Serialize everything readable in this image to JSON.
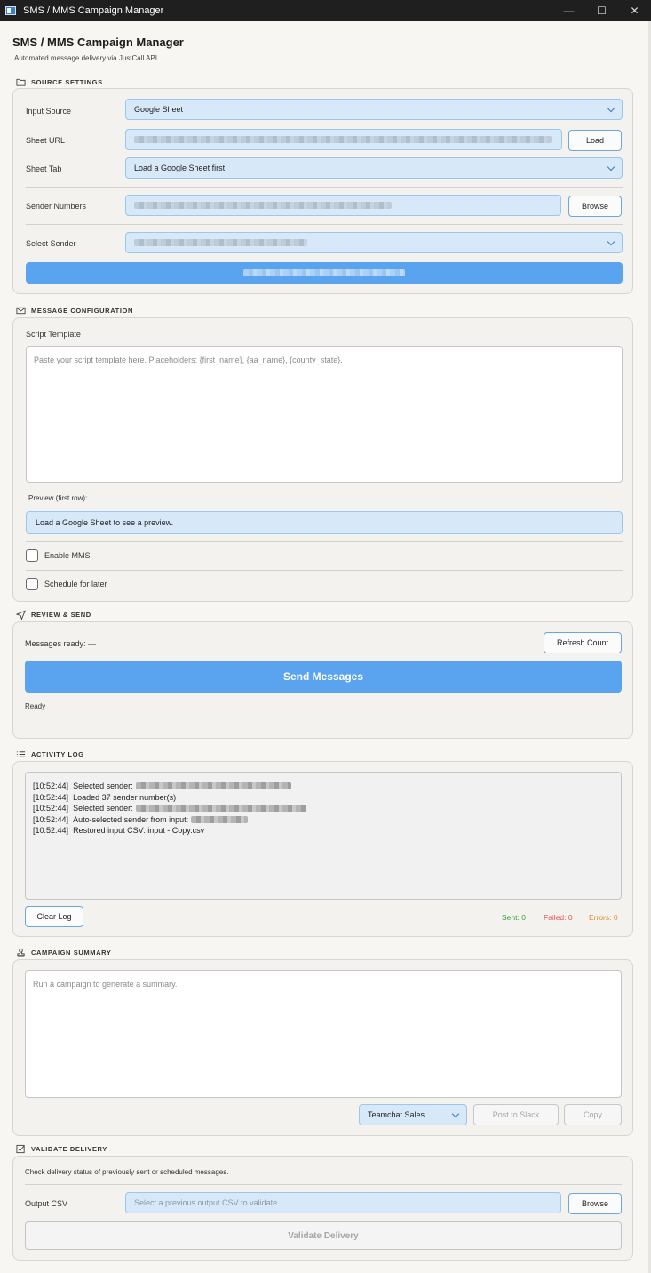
{
  "window": {
    "title": "SMS / MMS Campaign Manager",
    "controls": {
      "minimize": "—",
      "maximize": "☐",
      "close": "✕"
    }
  },
  "header": {
    "title": "SMS / MMS Campaign Manager",
    "subtitle": "Automated message delivery via JustCall API"
  },
  "source_settings": {
    "heading": "SOURCE SETTINGS",
    "input_source_label": "Input Source",
    "input_source_value": "Google Sheet",
    "sheet_url_label": "Sheet URL",
    "load_button": "Load",
    "sheet_tab_label": "Sheet Tab",
    "sheet_tab_value": "Load a Google Sheet first",
    "sender_numbers_label": "Sender Numbers",
    "browse_button": "Browse",
    "select_sender_label": "Select Sender"
  },
  "message_config": {
    "heading": "MESSAGE CONFIGURATION",
    "script_template_label": "Script Template",
    "script_placeholder": "Paste your script template here. Placeholders: {first_name}, {aa_name}, {county_state}.",
    "preview_label": "Preview (first row):",
    "preview_value": "Load a Google Sheet to see a preview.",
    "enable_mms": "Enable MMS",
    "schedule_later": "Schedule for later"
  },
  "review_send": {
    "heading": "REVIEW & SEND",
    "messages_ready": "Messages ready: —",
    "refresh_button": "Refresh Count",
    "send_button": "Send Messages",
    "status": "Ready"
  },
  "activity_log": {
    "heading": "ACTIVITY LOG",
    "lines": [
      {
        "time": "[10:52:44]",
        "text": "Selected sender:",
        "redacted": true
      },
      {
        "time": "[10:52:44]",
        "text": "Loaded 37 sender number(s)",
        "redacted": false
      },
      {
        "time": "[10:52:44]",
        "text": "Selected sender:",
        "redacted": true
      },
      {
        "time": "[10:52:44]",
        "text": "Auto-selected sender from input:",
        "redacted": true
      },
      {
        "time": "[10:52:44]",
        "text": "Restored input CSV: input - Copy.csv",
        "redacted": false
      }
    ],
    "clear_button": "Clear Log",
    "sent": "Sent: 0",
    "failed": "Failed: 0",
    "errors": "Errors: 0",
    "colors": {
      "sent": "#3aa33a",
      "failed": "#e05252",
      "errors": "#e08a2b"
    }
  },
  "campaign_summary": {
    "heading": "CAMPAIGN SUMMARY",
    "placeholder": "Run a campaign to generate a summary.",
    "channel_value": "Teamchat Sales",
    "post_button": "Post to Slack",
    "copy_button": "Copy"
  },
  "validate_delivery": {
    "heading": "VALIDATE DELIVERY",
    "description": "Check delivery status of previously sent or scheduled messages.",
    "output_csv_label": "Output CSV",
    "output_csv_placeholder": "Select a previous output CSV to validate",
    "browse_button": "Browse",
    "validate_button": "Validate Delivery"
  },
  "colors": {
    "accent": "#5aa3ef",
    "field_bg": "#d7e9f8",
    "field_border": "#9cc6ec"
  }
}
